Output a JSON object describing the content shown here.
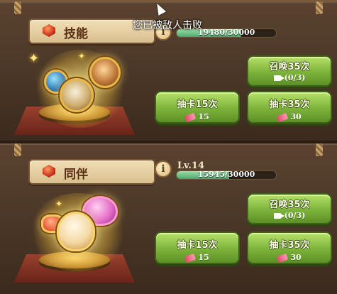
{
  "toast": "您已被敌人击败",
  "skill_panel": {
    "title": "技能",
    "progress": {
      "text": "19480/30000",
      "fraction": 0.649
    },
    "summon_button": {
      "label": "召唤35次",
      "sub": "(0/3)"
    },
    "draw15_button": {
      "label": "抽卡15次",
      "cost": "15"
    },
    "draw35_button": {
      "label": "抽卡35次",
      "cost": "30"
    }
  },
  "partner_panel": {
    "title": "同伴",
    "info_icon": "i",
    "level": "Lv.14",
    "progress": {
      "text": "15945/30000",
      "fraction": 0.531
    },
    "summon_button": {
      "label": "召唤35次",
      "sub": "(0/3)"
    },
    "draw15_button": {
      "label": "抽卡15次",
      "cost": "15"
    },
    "draw35_button": {
      "label": "抽卡35次",
      "cost": "30"
    }
  },
  "icons": {
    "title_gem": "red-gem-icon",
    "ticket": "ticket-icon",
    "video": "video-ad-icon",
    "info": "info-icon"
  },
  "colors": {
    "button_green": "#7cb33a",
    "progress_green": "#4aa86e",
    "title_bg": "#e8d3a6",
    "panel_brown": "#4a3626"
  }
}
